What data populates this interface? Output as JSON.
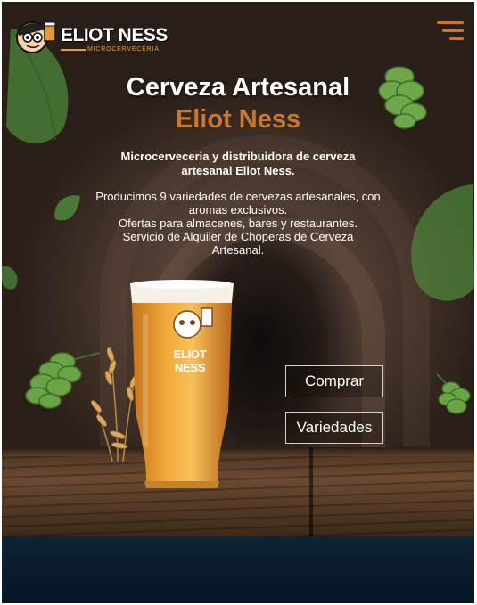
{
  "brand": {
    "name": "ELIOT NESS",
    "tagline": "MICROCERVECERIA"
  },
  "hero": {
    "title_line1": "Cerveza Artesanal",
    "title_line2": "Eliot Ness",
    "subtitle": "Microcerveceria y distribuidora de cerveza artesanal Eliot Ness.",
    "description": [
      "Producimos 9 variedades de cervezas artesanales, con aromas exclusivos.",
      "Ofertas para almacenes, bares y restaurantes.",
      "Servicio de Alquiler de Choperas de Cerveza Artesanal."
    ],
    "glass_logo_text": "ELIOT NESS"
  },
  "buttons": {
    "buy_label": "Comprar",
    "varieties_label": "Variedades"
  },
  "icons": {
    "menu": "hamburger-menu-icon",
    "logo": "beer-mascot-logo"
  },
  "colors": {
    "accent": "#c8772f",
    "menu_icon": "#c9792f",
    "bottom_band": "#0a1a2c"
  }
}
